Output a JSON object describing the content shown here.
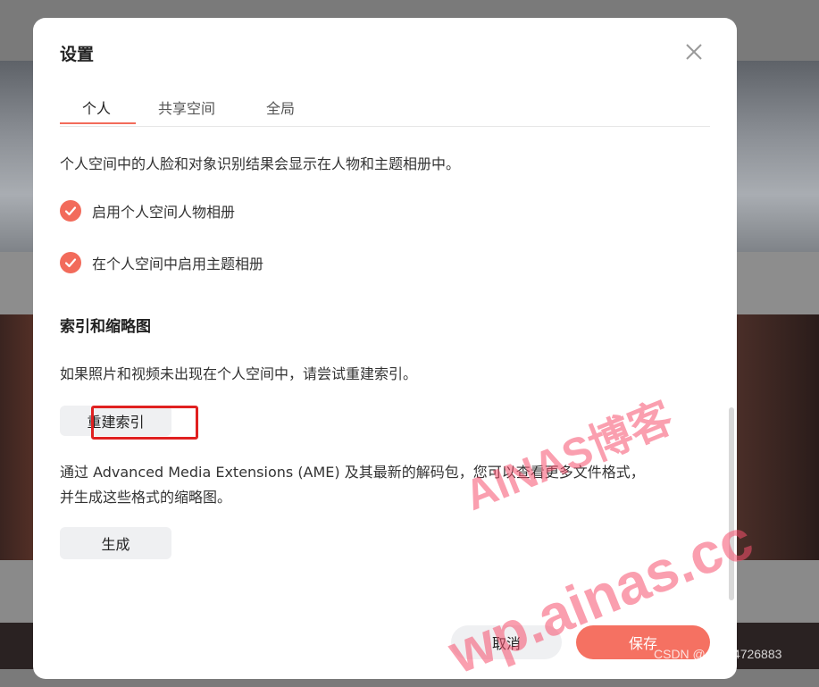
{
  "dialog": {
    "title": "设置",
    "tabs": [
      {
        "label": "个人",
        "active": true
      },
      {
        "label": "共享空间",
        "active": false
      },
      {
        "label": "全局",
        "active": false
      }
    ],
    "description": "个人空间中的人脸和对象识别结果会显示在人物和主题相册中。",
    "options": [
      {
        "label": "启用个人空间人物相册",
        "checked": true
      },
      {
        "label": "在个人空间中启用主题相册",
        "checked": true
      }
    ],
    "index_section": {
      "title": "索引和缩略图",
      "rebuild_hint": "如果照片和视频未出现在个人空间中，请尝试重建索引。",
      "rebuild_button": "重建索引",
      "ame_text_line1": "通过 Advanced Media Extensions (AME) 及其最新的解码包，您可以查看更多文件格式，",
      "ame_text_line2": "并生成这些格式的缩略图。",
      "generate_button": "生成"
    },
    "footer": {
      "cancel_label": "取消",
      "save_label": "保存"
    }
  },
  "watermarks": {
    "line1": "AINAS博客",
    "line2": "wp.ainas.cc",
    "credit": "CSDN @qq_44726883"
  },
  "colors": {
    "accent": "#f26b5b",
    "save_button": "#f57162",
    "highlight_border": "#e02020",
    "watermark": "#f5506e"
  },
  "icons": {
    "close": "close-icon",
    "check": "check-circle-icon"
  }
}
